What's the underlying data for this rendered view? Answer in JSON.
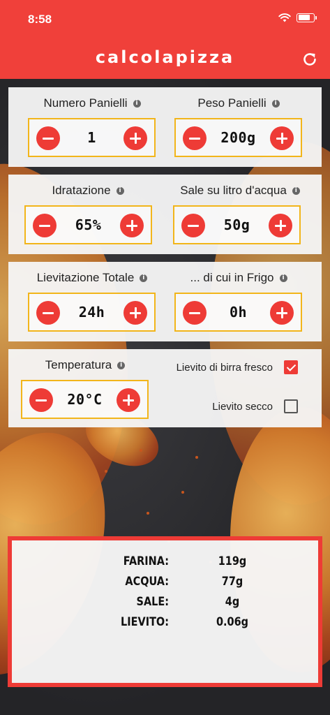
{
  "status": {
    "time": "8:58"
  },
  "header": {
    "title": "calcolapizza",
    "refresh_icon": "refresh-icon"
  },
  "colors": {
    "accent": "#f0403a",
    "stepper_border": "#f2b51a",
    "button": "#ee3b36"
  },
  "fields": {
    "numero_panielli": {
      "label": "Numero Panielli",
      "value": "1"
    },
    "peso_panielli": {
      "label": "Peso Panielli",
      "value": "200g"
    },
    "idratazione": {
      "label": "Idratazione",
      "value": "65%"
    },
    "sale": {
      "label": "Sale su litro d'acqua",
      "value": "50g"
    },
    "lievitazione": {
      "label": "Lievitazione Totale",
      "value": "24h"
    },
    "frigo": {
      "label": "... di cui in Frigo",
      "value": "0h"
    },
    "temperatura": {
      "label": "Temperatura",
      "value": "20°C"
    }
  },
  "yeast": {
    "fresco": {
      "label": "Lievito di birra fresco",
      "checked": true
    },
    "secco": {
      "label": "Lievito secco",
      "checked": false
    }
  },
  "results": [
    {
      "key": "FARINA:",
      "value": "119g"
    },
    {
      "key": "ACQUA:",
      "value": "77g"
    },
    {
      "key": "SALE:",
      "value": "4g"
    },
    {
      "key": "LIEVITO:",
      "value": "0.06g"
    }
  ]
}
